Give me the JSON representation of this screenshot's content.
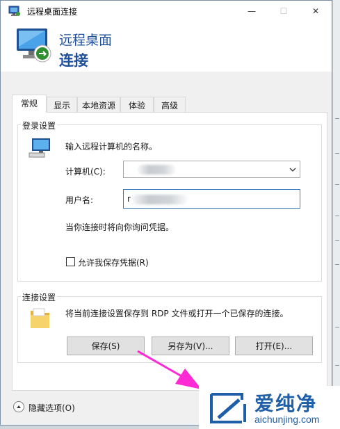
{
  "window": {
    "title": "远程桌面连接",
    "header_line1": "远程桌面",
    "header_line2": "连接",
    "min_glyph": "—",
    "max_glyph": "☐",
    "close_glyph": "✕"
  },
  "tabs": [
    {
      "label": "常规",
      "active": true
    },
    {
      "label": "显示",
      "active": false
    },
    {
      "label": "本地资源",
      "active": false
    },
    {
      "label": "体验",
      "active": false
    },
    {
      "label": "高级",
      "active": false
    }
  ],
  "login": {
    "group_label": "登录设置",
    "prompt": "输入远程计算机的名称。",
    "computer_label": "计算机(C):",
    "computer_value": "",
    "username_label": "用户名:",
    "username_value": "r",
    "info_text": "当你连接时将向你询问凭据。",
    "save_credentials_label": "允许我保存凭据(R)",
    "save_credentials_checked": false
  },
  "connection": {
    "group_label": "连接设置",
    "description": "将当前连接设置保存到 RDP 文件或打开一个已保存的连接。",
    "save_button": "保存(S)",
    "save_as_button": "另存为(V)...",
    "open_button": "打开(E)..."
  },
  "footer": {
    "hide_options_label": "隐藏选项(O)"
  },
  "watermark": {
    "brand": "爱纯净",
    "url": "aichunjing.com"
  },
  "colors": {
    "accent": "#1f4e9a",
    "arrow": "#ff2ad4"
  }
}
